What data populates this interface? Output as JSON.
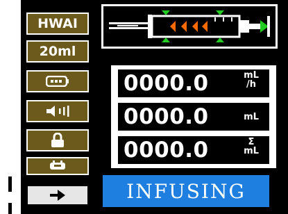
{
  "sidebar": {
    "mode_label": "HWAI",
    "syringe_size_label": "20ml",
    "battery_icon": "battery-icon",
    "volume_icon": "volume-icon",
    "lock_icon": "lock-icon",
    "power_icon": "power-plug-icon",
    "next_icon": "arrow-right-icon"
  },
  "readings": {
    "rate": {
      "value": "0000.0",
      "unit_top": "mL",
      "unit_bottom": "/h"
    },
    "volume": {
      "value": "0000.0",
      "unit": "mL"
    },
    "total": {
      "value": "0000.0",
      "unit_top": "Σ",
      "unit_bottom": "mL"
    }
  },
  "status": {
    "text": "INFUSING"
  },
  "colors": {
    "button_bg": "#6b5a1b",
    "status_bg": "#1e7fe0",
    "syringe_orange": "#ff6a00",
    "syringe_green": "#22cc22"
  }
}
